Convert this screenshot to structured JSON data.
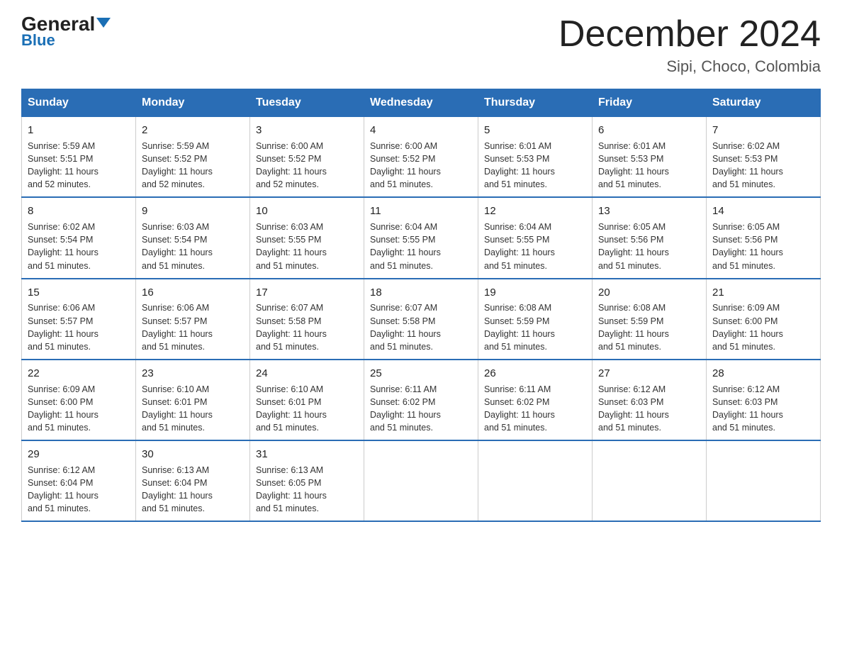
{
  "logo": {
    "general": "General",
    "blue": "Blue"
  },
  "title": "December 2024",
  "location": "Sipi, Choco, Colombia",
  "days_of_week": [
    "Sunday",
    "Monday",
    "Tuesday",
    "Wednesday",
    "Thursday",
    "Friday",
    "Saturday"
  ],
  "weeks": [
    [
      {
        "day": "1",
        "info": "Sunrise: 5:59 AM\nSunset: 5:51 PM\nDaylight: 11 hours\nand 52 minutes."
      },
      {
        "day": "2",
        "info": "Sunrise: 5:59 AM\nSunset: 5:52 PM\nDaylight: 11 hours\nand 52 minutes."
      },
      {
        "day": "3",
        "info": "Sunrise: 6:00 AM\nSunset: 5:52 PM\nDaylight: 11 hours\nand 52 minutes."
      },
      {
        "day": "4",
        "info": "Sunrise: 6:00 AM\nSunset: 5:52 PM\nDaylight: 11 hours\nand 51 minutes."
      },
      {
        "day": "5",
        "info": "Sunrise: 6:01 AM\nSunset: 5:53 PM\nDaylight: 11 hours\nand 51 minutes."
      },
      {
        "day": "6",
        "info": "Sunrise: 6:01 AM\nSunset: 5:53 PM\nDaylight: 11 hours\nand 51 minutes."
      },
      {
        "day": "7",
        "info": "Sunrise: 6:02 AM\nSunset: 5:53 PM\nDaylight: 11 hours\nand 51 minutes."
      }
    ],
    [
      {
        "day": "8",
        "info": "Sunrise: 6:02 AM\nSunset: 5:54 PM\nDaylight: 11 hours\nand 51 minutes."
      },
      {
        "day": "9",
        "info": "Sunrise: 6:03 AM\nSunset: 5:54 PM\nDaylight: 11 hours\nand 51 minutes."
      },
      {
        "day": "10",
        "info": "Sunrise: 6:03 AM\nSunset: 5:55 PM\nDaylight: 11 hours\nand 51 minutes."
      },
      {
        "day": "11",
        "info": "Sunrise: 6:04 AM\nSunset: 5:55 PM\nDaylight: 11 hours\nand 51 minutes."
      },
      {
        "day": "12",
        "info": "Sunrise: 6:04 AM\nSunset: 5:55 PM\nDaylight: 11 hours\nand 51 minutes."
      },
      {
        "day": "13",
        "info": "Sunrise: 6:05 AM\nSunset: 5:56 PM\nDaylight: 11 hours\nand 51 minutes."
      },
      {
        "day": "14",
        "info": "Sunrise: 6:05 AM\nSunset: 5:56 PM\nDaylight: 11 hours\nand 51 minutes."
      }
    ],
    [
      {
        "day": "15",
        "info": "Sunrise: 6:06 AM\nSunset: 5:57 PM\nDaylight: 11 hours\nand 51 minutes."
      },
      {
        "day": "16",
        "info": "Sunrise: 6:06 AM\nSunset: 5:57 PM\nDaylight: 11 hours\nand 51 minutes."
      },
      {
        "day": "17",
        "info": "Sunrise: 6:07 AM\nSunset: 5:58 PM\nDaylight: 11 hours\nand 51 minutes."
      },
      {
        "day": "18",
        "info": "Sunrise: 6:07 AM\nSunset: 5:58 PM\nDaylight: 11 hours\nand 51 minutes."
      },
      {
        "day": "19",
        "info": "Sunrise: 6:08 AM\nSunset: 5:59 PM\nDaylight: 11 hours\nand 51 minutes."
      },
      {
        "day": "20",
        "info": "Sunrise: 6:08 AM\nSunset: 5:59 PM\nDaylight: 11 hours\nand 51 minutes."
      },
      {
        "day": "21",
        "info": "Sunrise: 6:09 AM\nSunset: 6:00 PM\nDaylight: 11 hours\nand 51 minutes."
      }
    ],
    [
      {
        "day": "22",
        "info": "Sunrise: 6:09 AM\nSunset: 6:00 PM\nDaylight: 11 hours\nand 51 minutes."
      },
      {
        "day": "23",
        "info": "Sunrise: 6:10 AM\nSunset: 6:01 PM\nDaylight: 11 hours\nand 51 minutes."
      },
      {
        "day": "24",
        "info": "Sunrise: 6:10 AM\nSunset: 6:01 PM\nDaylight: 11 hours\nand 51 minutes."
      },
      {
        "day": "25",
        "info": "Sunrise: 6:11 AM\nSunset: 6:02 PM\nDaylight: 11 hours\nand 51 minutes."
      },
      {
        "day": "26",
        "info": "Sunrise: 6:11 AM\nSunset: 6:02 PM\nDaylight: 11 hours\nand 51 minutes."
      },
      {
        "day": "27",
        "info": "Sunrise: 6:12 AM\nSunset: 6:03 PM\nDaylight: 11 hours\nand 51 minutes."
      },
      {
        "day": "28",
        "info": "Sunrise: 6:12 AM\nSunset: 6:03 PM\nDaylight: 11 hours\nand 51 minutes."
      }
    ],
    [
      {
        "day": "29",
        "info": "Sunrise: 6:12 AM\nSunset: 6:04 PM\nDaylight: 11 hours\nand 51 minutes."
      },
      {
        "day": "30",
        "info": "Sunrise: 6:13 AM\nSunset: 6:04 PM\nDaylight: 11 hours\nand 51 minutes."
      },
      {
        "day": "31",
        "info": "Sunrise: 6:13 AM\nSunset: 6:05 PM\nDaylight: 11 hours\nand 51 minutes."
      },
      {
        "day": "",
        "info": ""
      },
      {
        "day": "",
        "info": ""
      },
      {
        "day": "",
        "info": ""
      },
      {
        "day": "",
        "info": ""
      }
    ]
  ]
}
